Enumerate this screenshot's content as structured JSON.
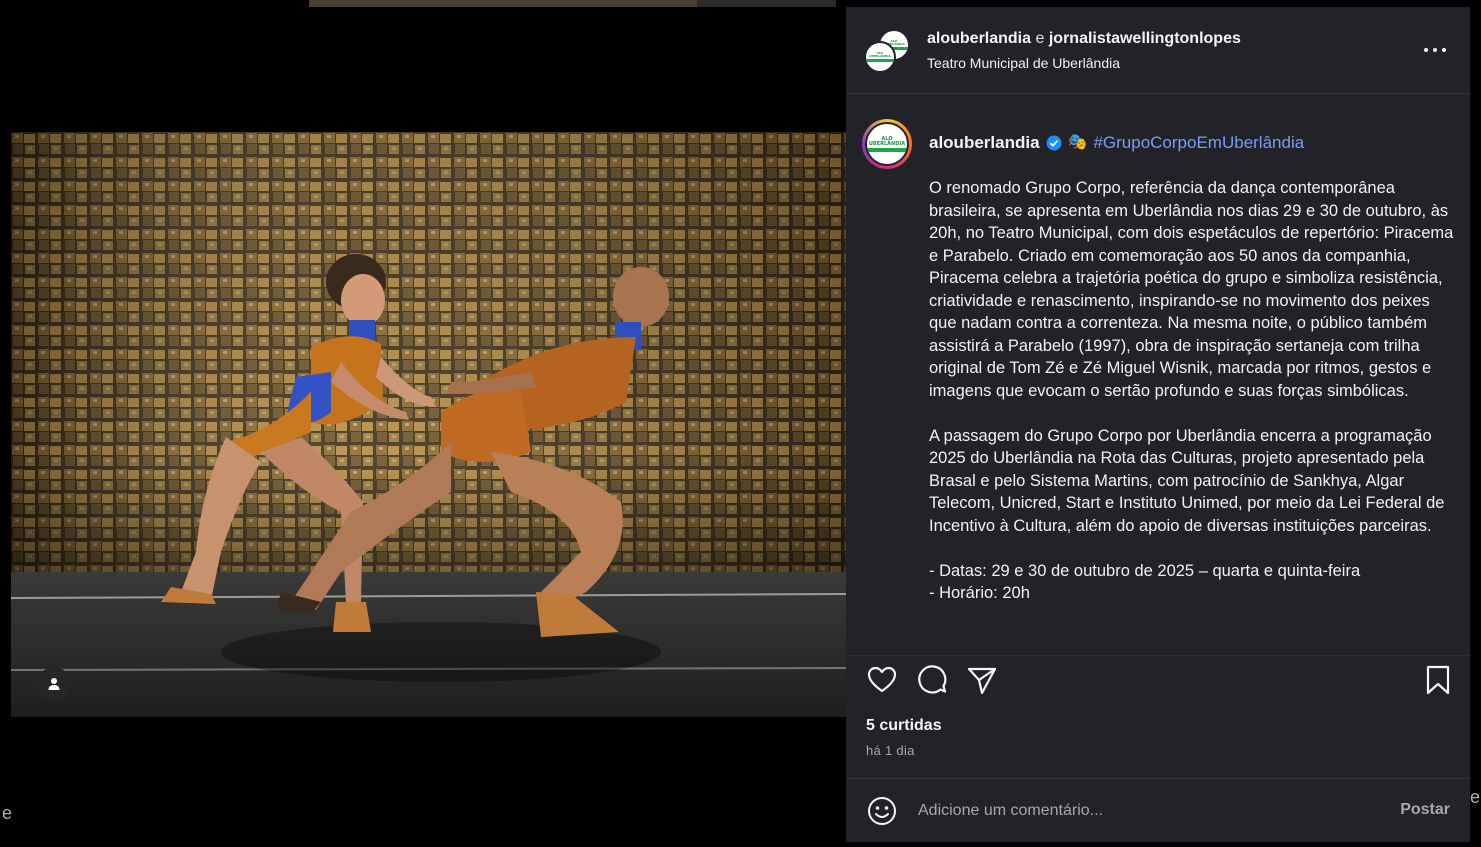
{
  "post": {
    "header": {
      "author": "alouberlandia",
      "separator": "e",
      "coauthor": "jornalistawellingtonlopes",
      "location": "Teatro Municipal de Uberlândia",
      "more_icon": "more-horizontal-icon"
    },
    "logo_text": "ALO UBERLÂNDIA",
    "caption": {
      "username": "alouberlandia",
      "verified_icon": "verified-badge-icon",
      "emoji": "🎭",
      "hashtag": "#GrupoCorpoEmUberlândia",
      "body": "O renomado Grupo Corpo, referência da dança contemporânea brasileira, se apresenta em Uberlândia nos dias 29 e 30 de outubro, às 20h, no Teatro Municipal, com dois espetáculos de repertório: Piracema e Parabelo. Criado em comemoração aos 50 anos da companhia, Piracema celebra a trajetória poética do grupo e simboliza resistência, criatividade e renascimento, inspirando-se no movimento dos peixes que nadam contra a correnteza. Na mesma noite, o público também assistirá a Parabelo (1997), obra de inspiração sertaneja com trilha original de Tom Zé e Zé Miguel Wisnik, marcada por ritmos, gestos e imagens que evocam o sertão profundo e suas forças simbólicas.\n\nA passagem do Grupo Corpo por Uberlândia encerra a programação 2025 do Uberlândia na Rota das Culturas, projeto apresentado pela Brasal e pelo Sistema Martins, com patrocínio de Sankhya, Algar Telecom, Unicred, Start e Instituto Unimed, por meio da Lei Federal de Incentivo à Cultura, além do apoio de diversas instituições parceiras.\n\n- Datas: 29 e 30 de outubro de 2025 – quarta e quinta-feira\n- Horário: 20h"
    },
    "actions": {
      "like_icon": "heart-icon",
      "comment_icon": "comment-icon",
      "share_icon": "share-icon",
      "save_icon": "bookmark-icon"
    },
    "likes": "5 curtidas",
    "time_ago": "há 1 dia",
    "comment_box": {
      "emoji_icon": "emoji-icon",
      "placeholder": "Adicione um comentário...",
      "post_label": "Postar"
    },
    "media": {
      "tag_icon": "user-tag-icon"
    }
  },
  "backdrop": {
    "edge_char_left": "e",
    "edge_char_right": "e"
  },
  "colors": {
    "panel_bg": "#212328",
    "hashtag": "#7a9cf5",
    "verified": "#1d8cf3",
    "muted": "#a8a8a8"
  }
}
